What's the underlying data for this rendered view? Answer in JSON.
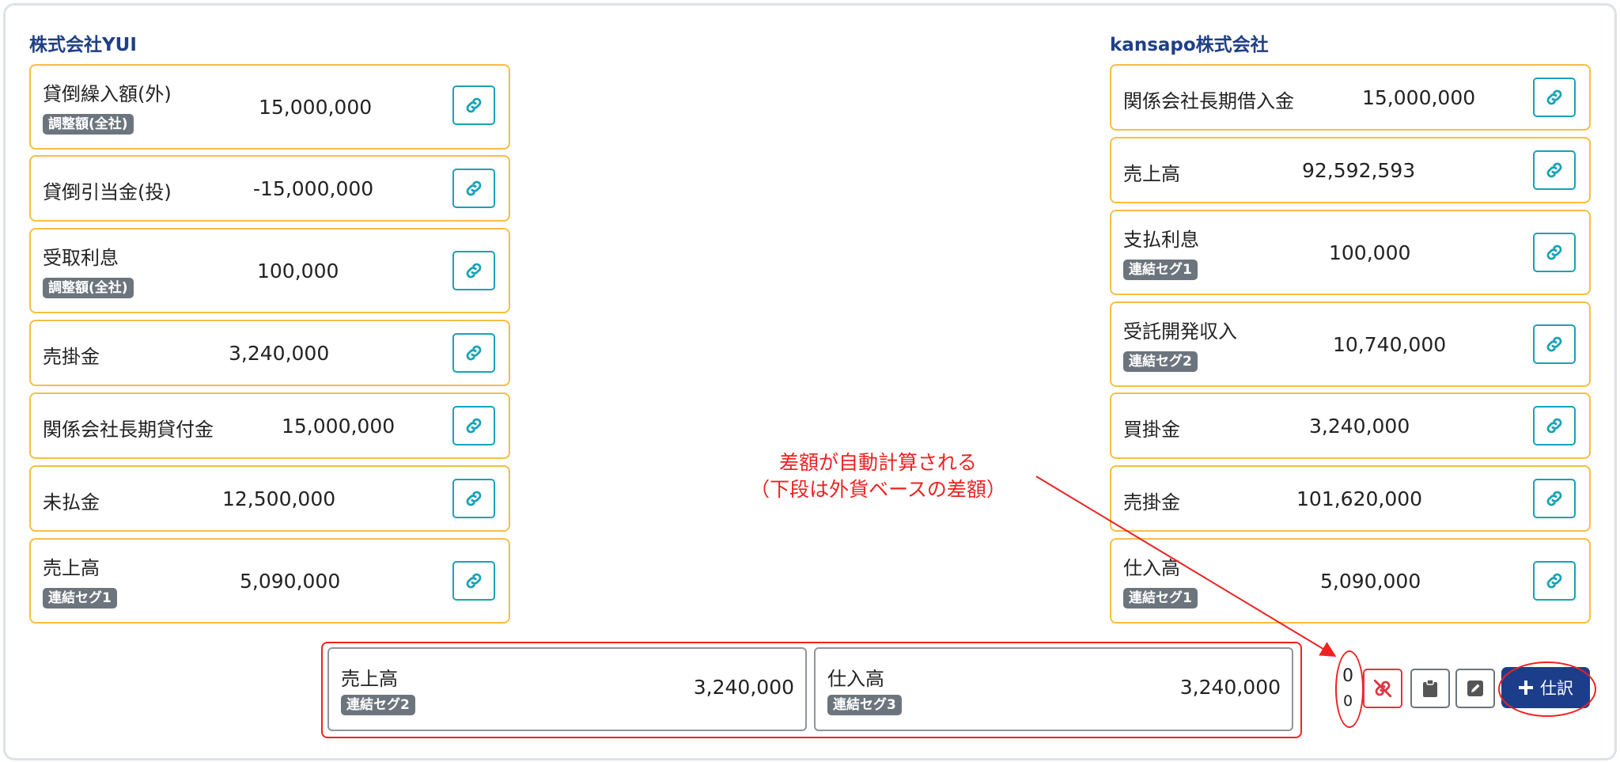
{
  "left_company": {
    "title": "株式会社YUI",
    "items": [
      {
        "label": "貸倒繰入額(外)",
        "amount": "15,000,000",
        "badge": "調整額(全社)"
      },
      {
        "label": "貸倒引当金(投)",
        "amount": "-15,000,000"
      },
      {
        "label": "受取利息",
        "amount": "100,000",
        "badge": "調整額(全社)"
      },
      {
        "label": "売掛金",
        "amount": "3,240,000"
      },
      {
        "label": "関係会社長期貸付金",
        "amount": "15,000,000"
      },
      {
        "label": "未払金",
        "amount": "12,500,000"
      },
      {
        "label": "売上高",
        "amount": "5,090,000",
        "badge": "連結セグ1"
      }
    ]
  },
  "right_company": {
    "title": "kansapo株式会社",
    "items": [
      {
        "label": "関係会社長期借入金",
        "amount": "15,000,000"
      },
      {
        "label": "売上高",
        "amount": "92,592,593"
      },
      {
        "label": "支払利息",
        "amount": "100,000",
        "badge": "連結セグ1"
      },
      {
        "label": "受託開発収入",
        "amount": "10,740,000",
        "badge": "連結セグ2"
      },
      {
        "label": "買掛金",
        "amount": "3,240,000"
      },
      {
        "label": "売掛金",
        "amount": "101,620,000"
      },
      {
        "label": "仕入高",
        "amount": "5,090,000",
        "badge": "連結セグ1"
      }
    ]
  },
  "journal": {
    "debit": {
      "label": "売上高",
      "badge": "連結セグ2",
      "amount": "3,240,000"
    },
    "credit": {
      "label": "仕入高",
      "badge": "連結セグ3",
      "amount": "3,240,000"
    }
  },
  "difference": {
    "value": "0",
    "foreign_value": "0"
  },
  "annotation": {
    "line1": "差額が自動計算される",
    "line2": "（下段は外貨ベースの差額）"
  },
  "toolbar": {
    "add_journal_label": "仕訳"
  },
  "icons": {
    "link": "link-icon",
    "unlink": "unlink-icon",
    "clipboard": "clipboard-icon",
    "edit": "edit-icon",
    "plus": "plus-icon"
  },
  "colors": {
    "card_border": "#f6be44",
    "link_button": "#17a2b8",
    "badge": "#6c757d",
    "title": "#1f3f86",
    "primary_button": "#1c3d8a",
    "annotation": "#ee2222",
    "unlink_button": "#dc3545"
  }
}
